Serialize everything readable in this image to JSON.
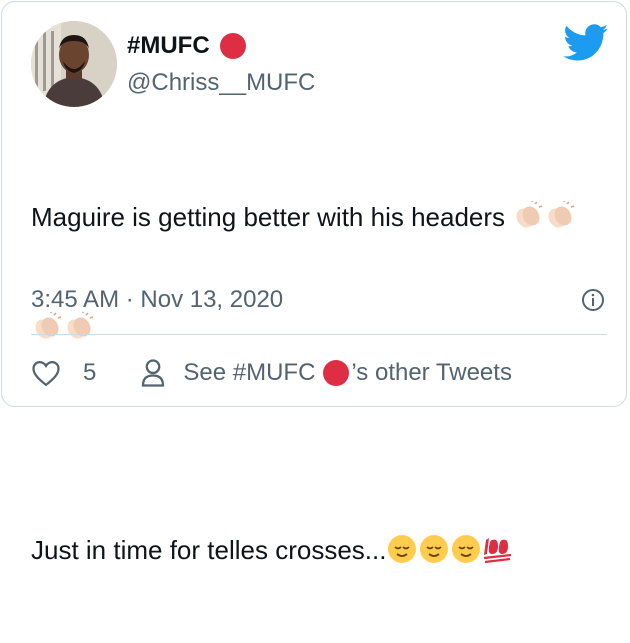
{
  "user": {
    "display_name": "#MUFC",
    "handle": "@Chriss__MUFC"
  },
  "tweet": {
    "line1_text": "Maguire is getting better with his headers ",
    "line3_text": "Just in time for telles crosses...",
    "emojis": [
      "clapping-hands",
      "relieved-face",
      "hundred-points"
    ]
  },
  "timestamp": "3:45 AM · Nov 13, 2020",
  "actions": {
    "like_count": "5",
    "see_prefix": "See #MUFC",
    "see_suffix": "’s other Tweets"
  },
  "colors": {
    "brand": "#1d9bf0",
    "text_primary": "#0f1419",
    "text_secondary": "#536471",
    "border": "#cfd9de",
    "red_circle": "#dd2e44"
  }
}
